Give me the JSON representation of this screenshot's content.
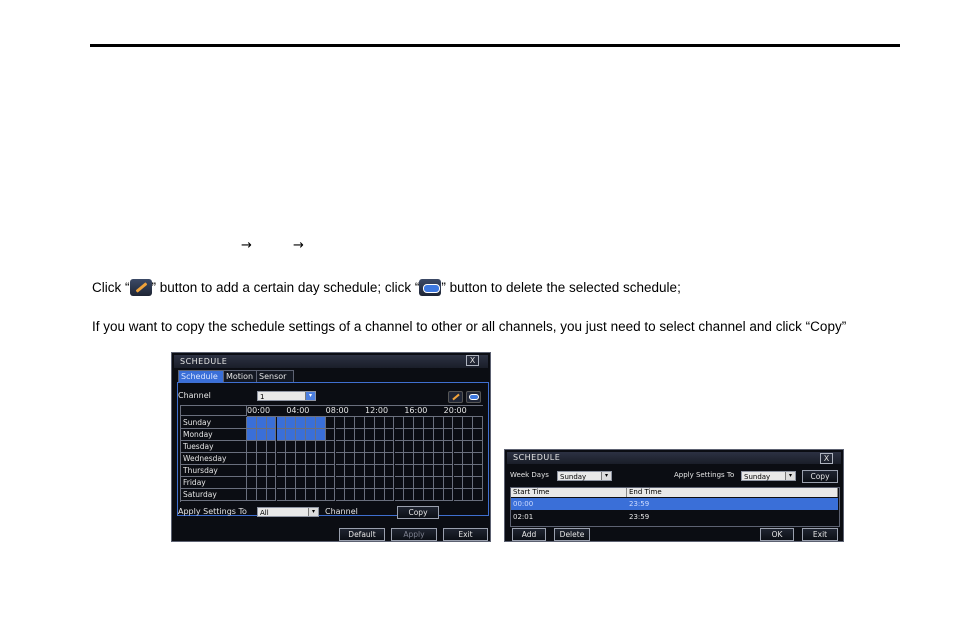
{
  "doc": {
    "arrow1": "→",
    "arrow2": "→",
    "line1_pre": "Click “",
    "line1_mid": "” button to add a certain day schedule; click “",
    "line1_post": "” button to delete the selected schedule;",
    "line2": "If you want to copy the schedule settings of a channel to other or all channels, you just need to select channel and click “Copy”",
    "icons": {
      "add": "pencil-add-icon",
      "delete": "eraser-delete-icon"
    }
  },
  "schedule_window": {
    "title": "SCHEDULE",
    "close": "X",
    "tabs": [
      "Schedule",
      "Motion",
      "Sensor"
    ],
    "channel_label": "Channel",
    "channel_value": "1",
    "hours": [
      "00:00",
      "04:00",
      "08:00",
      "12:00",
      "16:00",
      "20:00"
    ],
    "days": [
      "Sunday",
      "Monday",
      "Tuesday",
      "Wednesday",
      "Thursday",
      "Friday",
      "Saturday"
    ],
    "highlight": {
      "days": [
        "Sunday",
        "Monday"
      ],
      "from": "00:00",
      "to": "08:00"
    },
    "apply_label": "Apply Settings To",
    "apply_value": "All",
    "channel_label2": "Channel",
    "copy": "Copy",
    "default": "Default",
    "apply": "Apply",
    "exit": "Exit",
    "colors": {
      "highlight": "#3a6fd8",
      "background": "#0b0d13"
    }
  },
  "day_window": {
    "title": "SCHEDULE",
    "close": "X",
    "week_days_label": "Week Days",
    "week_days_value": "Sunday",
    "apply_label": "Apply Settings To",
    "apply_value": "Sunday",
    "copy": "Copy",
    "columns": [
      "Start Time",
      "End Time"
    ],
    "rows": [
      {
        "start": "00:00",
        "end": "23:59",
        "selected": true
      },
      {
        "start": "02:01",
        "end": "23:59",
        "selected": false
      }
    ],
    "add": "Add",
    "delete": "Delete",
    "ok": "OK",
    "exit": "Exit"
  }
}
